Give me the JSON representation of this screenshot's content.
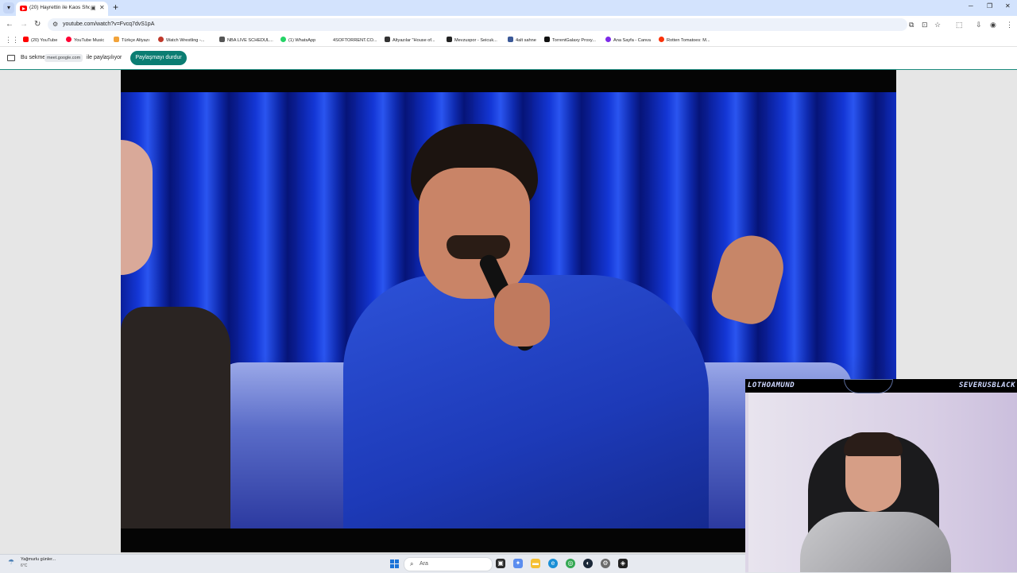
{
  "browser": {
    "tab": {
      "title": "(20) Hayrettin ile Kaos Show..."
    },
    "address": {
      "url": "youtube.com/watch?v=Fvcq7dvS1pA"
    },
    "bookmarks": [
      {
        "label": "(20) YouTube",
        "color": "#ff0000"
      },
      {
        "label": "YouTube Music",
        "color": "#ff0033"
      },
      {
        "label": "Türkçe Altyazı",
        "color": "#f2a33a"
      },
      {
        "label": "Watch Wrestling -...",
        "color": "#c0392b"
      },
      {
        "label": "NBA LIVE SCHEDUL...",
        "color": "#555555"
      },
      {
        "label": "(1) WhatsApp",
        "color": "#25d366"
      },
      {
        "label": "4SOFTORRENT.CO...",
        "color": "#ffffff"
      },
      {
        "label": "Altyazılar \"House of...",
        "color": "#333333"
      },
      {
        "label": "Mevzuspor - Seicuk...",
        "color": "#222222"
      },
      {
        "label": "4alt sahne",
        "color": "#3b5998"
      },
      {
        "label": "TorrentGalaxy Proxy...",
        "color": "#111111"
      },
      {
        "label": "Ana Sayfa - Canva",
        "color": "#7d2ae8"
      },
      {
        "label": "Rotten Tomatoes: M...",
        "color": "#fa320a"
      }
    ]
  },
  "sharebar": {
    "prefix": "Bu sekme",
    "site": "meet.google.com",
    "suffix": "ile paylaşılıyor",
    "stop_label": "Paylaşmayı durdur"
  },
  "webcam": {
    "left_name": "LOTHOAMUND",
    "right_name": "SEVERUSBLACK"
  },
  "taskbar": {
    "weather": "Yağmurlu günler...",
    "temperature": "6°C",
    "search_placeholder": "Ara"
  }
}
